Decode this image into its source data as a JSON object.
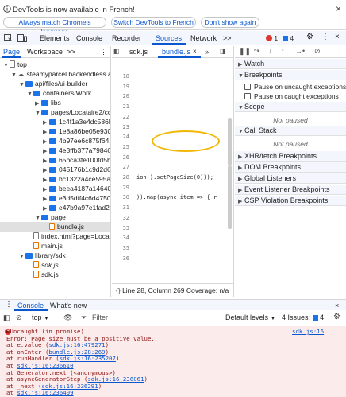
{
  "infobar": {
    "message": "DevTools is now available in French!",
    "buttons": [
      "Always match Chrome's language",
      "Switch DevTools to French",
      "Don't show again"
    ]
  },
  "tabs": {
    "items": [
      "Elements",
      "Console",
      "Recorder",
      "Sources",
      "Network"
    ],
    "selected": "Sources",
    "more": ">>",
    "errors": "1",
    "issues": "4"
  },
  "navigator": {
    "tabs": [
      "Page",
      "Workspace"
    ],
    "more": ">>",
    "tree": [
      {
        "label": "top",
        "type": "frame",
        "depth": 0,
        "open": true
      },
      {
        "label": "steamyparcel.backendless.app",
        "type": "cloud",
        "depth": 1,
        "open": true
      },
      {
        "label": "api/files/ui-builder",
        "type": "folder",
        "depth": 2,
        "open": true
      },
      {
        "label": "containers/Work",
        "type": "folder",
        "depth": 3,
        "open": true
      },
      {
        "label": "libs",
        "type": "folder",
        "depth": 4,
        "open": false
      },
      {
        "label": "pages/Locataire2/components",
        "type": "folder",
        "depth": 4,
        "open": true
      },
      {
        "label": "1c4f1a3e4dc586bd",
        "type": "folder",
        "depth": 5,
        "open": false
      },
      {
        "label": "1e8a86be05e93097",
        "type": "folder",
        "depth": 5,
        "open": false
      },
      {
        "label": "4b97ee6c875f64a8",
        "type": "folder",
        "depth": 5,
        "open": false
      },
      {
        "label": "4e3ffb377a79846f",
        "type": "folder",
        "depth": 5,
        "open": false
      },
      {
        "label": "65bca3fe100fd5b8",
        "type": "folder",
        "depth": 5,
        "open": false
      },
      {
        "label": "045176b1c9d2d6de",
        "type": "folder",
        "depth": 5,
        "open": false
      },
      {
        "label": "bc1322a4ce595af4",
        "type": "folder",
        "depth": 5,
        "open": false
      },
      {
        "label": "beea4187a14640dc",
        "type": "folder",
        "depth": 5,
        "open": false
      },
      {
        "label": "e3d5dff4c6d47501",
        "type": "folder",
        "depth": 5,
        "open": false
      },
      {
        "label": "e47b9a97e1fad2db",
        "type": "folder",
        "depth": 5,
        "open": false
      },
      {
        "label": "page",
        "type": "folder",
        "depth": 4,
        "open": true
      },
      {
        "label": "bundle.js",
        "type": "jsfile",
        "depth": 5,
        "selected": true
      },
      {
        "label": "index.html?page=Locataire2",
        "type": "htmlfile",
        "depth": 3
      },
      {
        "label": "main.js",
        "type": "jsfile",
        "depth": 3
      },
      {
        "label": "library/sdk",
        "type": "folder",
        "depth": 2,
        "open": true
      },
      {
        "label": "sdk.js",
        "type": "jsfile",
        "depth": 3,
        "italic": true
      },
      {
        "label": "sdk.js",
        "type": "jsfile",
        "depth": 3
      }
    ]
  },
  "editor": {
    "tabs": [
      "sdk.js",
      "bundle.js"
    ],
    "selected": "bundle.js",
    "lines": [
      {
        "n": "18",
        "code": ""
      },
      {
        "n": "19",
        "code": ""
      },
      {
        "n": "20",
        "code": ""
      },
      {
        "n": "21",
        "code": ""
      },
      {
        "n": "22",
        "code": ""
      },
      {
        "n": "23",
        "code": ""
      },
      {
        "n": "24",
        "code": ""
      },
      {
        "n": "25",
        "code": ""
      },
      {
        "n": "26",
        "code": ""
      },
      {
        "n": "27",
        "code": ""
      },
      {
        "n": "28",
        "code": "ion').setPageSize(0)));"
      },
      {
        "n": "29",
        "code": ""
      },
      {
        "n": "30",
        "code": ")).map(async item => { r"
      },
      {
        "n": "31",
        "code": ""
      },
      {
        "n": "32",
        "code": ""
      },
      {
        "n": "33",
        "code": ""
      },
      {
        "n": "34",
        "code": ""
      },
      {
        "n": "35",
        "code": ""
      },
      {
        "n": "36",
        "code": ""
      }
    ],
    "status": "Line 28, Column 269  Coverage: n/a"
  },
  "debugger": {
    "watch": "Watch",
    "breakpoints": "Breakpoints",
    "bp_uncaught": "Pause on uncaught exceptions",
    "bp_caught": "Pause on caught exceptions",
    "scope": "Scope",
    "scope_status": "Not paused",
    "callstack": "Call Stack",
    "callstack_status": "Not paused",
    "sections": [
      "XHR/fetch Breakpoints",
      "DOM Breakpoints",
      "Global Listeners",
      "Event Listener Breakpoints",
      "CSP Violation Breakpoints"
    ]
  },
  "drawer": {
    "tabs": [
      "Console",
      "What's new"
    ],
    "context": "top",
    "filter_placeholder": "Filter",
    "levels": "Default levels",
    "issues": "4 Issues:",
    "issues_count": "4"
  },
  "console": {
    "lines": [
      {
        "text": "▶Uncaught (in promise)",
        "link": "sdk.js:16"
      },
      {
        "text": "Error: Page size must be a positive value."
      },
      {
        "text": "    at e.value (",
        "link": "sdk.js:16:479271",
        "tail": ")"
      },
      {
        "text": "    at onEnter (",
        "link": "bundle.js:28:269",
        "tail": ")"
      },
      {
        "text": "    at runHandler (",
        "link": "sdk.js:16:235207",
        "tail": ")"
      },
      {
        "text": "    at ",
        "link": "sdk.js:16:236610"
      },
      {
        "text": "    at Generator.next (<anonymous>)"
      },
      {
        "text": "    at asyncGeneratorStep (",
        "link": "sdk.js:16:236061",
        "tail": ")"
      },
      {
        "text": "    at _next (",
        "link": "sdk.js:16:236291",
        "tail": ")"
      },
      {
        "text": "    at ",
        "link": "sdk.js:16:236409"
      }
    ]
  }
}
